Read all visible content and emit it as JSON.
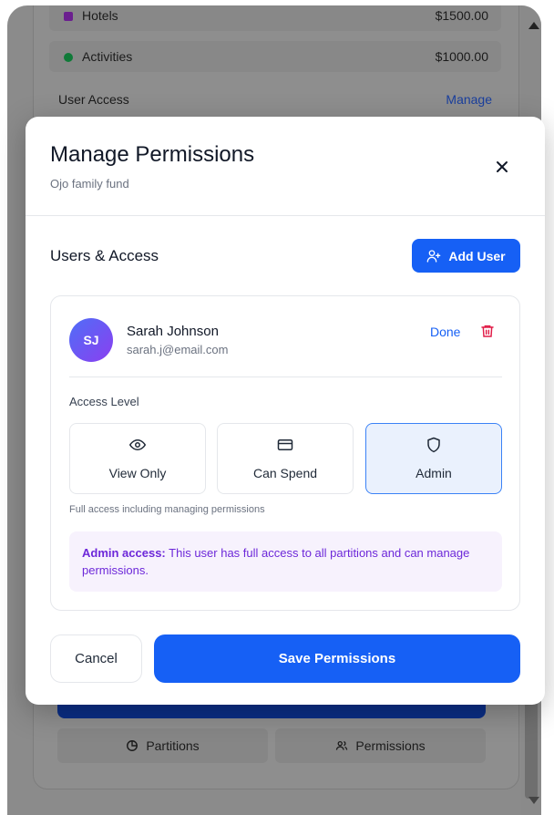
{
  "background": {
    "categories": [
      {
        "label": "Hotels",
        "amount": "$1500.00",
        "color": "#6b1f8f"
      },
      {
        "label": "Activities",
        "amount": "$1000.00",
        "color": "#0f7a38"
      }
    ],
    "user_access_label": "User Access",
    "manage_link": "Manage",
    "tabs": [
      {
        "label": "Partitions",
        "icon": "pie-chart-icon"
      },
      {
        "label": "Permissions",
        "icon": "users-icon"
      }
    ]
  },
  "modal": {
    "title": "Manage Permissions",
    "subtitle": "Ojo family fund",
    "close_icon": "close-icon",
    "section_title": "Users & Access",
    "add_user_label": "Add User",
    "user": {
      "initials": "SJ",
      "name": "Sarah Johnson",
      "email": "sarah.j@email.com",
      "done_label": "Done"
    },
    "access_level_label": "Access Level",
    "options": [
      {
        "label": "View Only",
        "icon": "eye-icon"
      },
      {
        "label": "Can Spend",
        "icon": "credit-card-icon"
      },
      {
        "label": "Admin",
        "icon": "shield-icon"
      }
    ],
    "selected_option": "Admin",
    "option_description": "Full access including managing permissions",
    "note_bold": "Admin access:",
    "note_text": " This user has full access to all partitions and can manage permissions.",
    "cancel_label": "Cancel",
    "save_label": "Save Permissions"
  },
  "colors": {
    "primary": "#1660f5",
    "danger": "#e11d48",
    "note_text": "#6d28d9"
  }
}
